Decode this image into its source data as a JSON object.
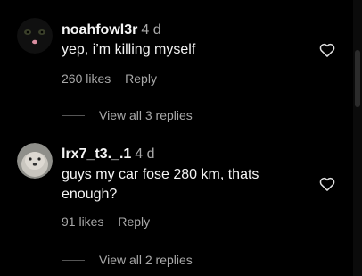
{
  "comments": [
    {
      "username": "noahfowl3r",
      "time": "4 d",
      "text": "yep, i’m killing myself",
      "likes": "260 likes",
      "reply": "Reply",
      "view_replies": "View all 3 replies",
      "avatar": "black-cat-avatar"
    },
    {
      "username": "lrx7_t3._.1",
      "time": "4 d",
      "text": "guys my car fose 280 km, thats enough?",
      "likes": "91 likes",
      "reply": "Reply",
      "view_replies": "View all 2 replies",
      "avatar": "seal-avatar"
    }
  ],
  "icons": {
    "like": "heart-icon"
  },
  "colors": {
    "background": "#000000",
    "text": "#f5f5f5",
    "secondary": "#a8a8a8"
  }
}
